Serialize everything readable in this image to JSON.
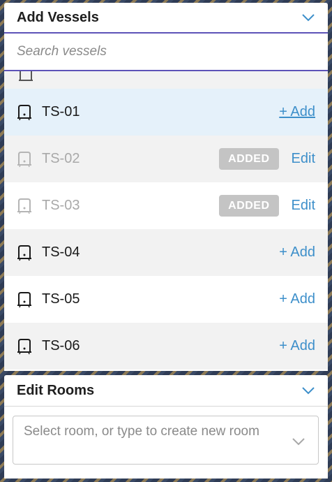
{
  "vessels_panel": {
    "title": "Add Vessels",
    "search_placeholder": "Search vessels"
  },
  "vessels": [
    {
      "name": "TS-01",
      "status": "available",
      "action_label": "+ Add"
    },
    {
      "name": "TS-02",
      "status": "added",
      "badge_label": "ADDED",
      "action_label": "Edit"
    },
    {
      "name": "TS-03",
      "status": "added",
      "badge_label": "ADDED",
      "action_label": "Edit"
    },
    {
      "name": "TS-04",
      "status": "available",
      "action_label": "+ Add"
    },
    {
      "name": "TS-05",
      "status": "available",
      "action_label": "+ Add"
    },
    {
      "name": "TS-06",
      "status": "available",
      "action_label": "+ Add"
    }
  ],
  "rooms_panel": {
    "title": "Edit Rooms",
    "select_placeholder": "Select room, or type to create new room"
  },
  "colors": {
    "accent_blue": "#3d8fca",
    "search_border": "#5d53b8",
    "highlight_row": "#e5f1fa",
    "badge_gray": "#c4c4c4"
  },
  "icons": {
    "vessel": "tank-icon",
    "collapse": "chevron-down-icon"
  }
}
